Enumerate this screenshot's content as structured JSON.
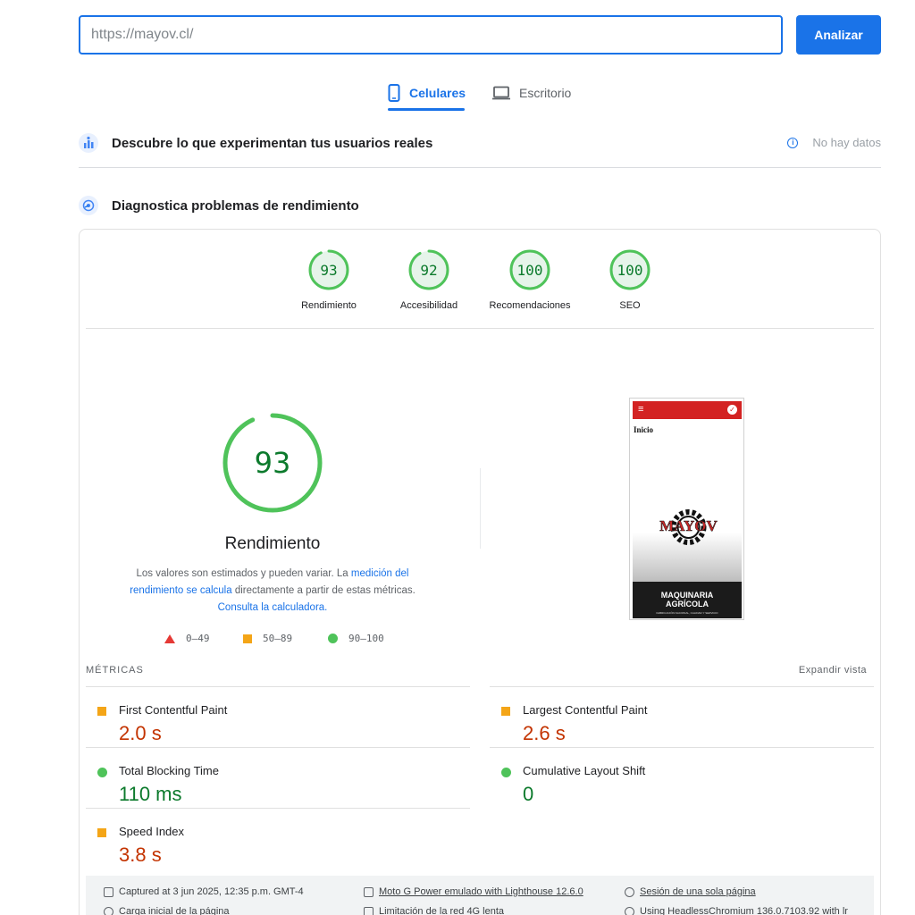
{
  "search": {
    "value": "https://mayov.cl/",
    "button": "Analizar"
  },
  "tabs": [
    {
      "label": "Celulares",
      "icon": "smartphone-icon",
      "active": true
    },
    {
      "label": "Escritorio",
      "icon": "laptop-icon",
      "active": false
    }
  ],
  "field_data": {
    "title": "Descubre lo que experimentan tus usuarios reales",
    "status": "No hay datos"
  },
  "lab_data": {
    "title": "Diagnostica problemas de rendimiento"
  },
  "categories": [
    {
      "score": "93",
      "label": "Rendimiento",
      "value": 93
    },
    {
      "score": "92",
      "label": "Accesibilidad",
      "value": 92
    },
    {
      "score": "100",
      "label": "Recomendaciones",
      "value": 100
    },
    {
      "score": "100",
      "label": "SEO",
      "value": 100
    }
  ],
  "performance": {
    "score": "93",
    "value": 93,
    "label": "Rendimiento",
    "desc_1": "Los valores son estimados y pueden variar. La ",
    "desc_link_1": "medición del rendimiento se calcula",
    "desc_2": " directamente a partir de estas métricas. ",
    "desc_link_2": "Consulta la calculadora."
  },
  "legend": [
    {
      "range": "0–49",
      "shape": "triangle",
      "color": "#e53935"
    },
    {
      "range": "50–89",
      "shape": "square",
      "color": "#f4a517"
    },
    {
      "range": "90–100",
      "shape": "circle",
      "color": "#4fc35a"
    }
  ],
  "preview": {
    "page_heading": "Inicio",
    "brand": "MAYOV",
    "tagline_1": "MAQUINARIA",
    "tagline_2": "AGRÍCOLA",
    "fine_print": "FABRICACIÓN NACIONAL, CALIDAD Y SERVICIO"
  },
  "metrics": {
    "title": "MÉTRICAS",
    "expand": "Expandir vista",
    "items": [
      {
        "name": "First Contentful Paint",
        "value": "2.0 s",
        "rating": "average"
      },
      {
        "name": "Largest Contentful Paint",
        "value": "2.6 s",
        "rating": "average"
      },
      {
        "name": "Total Blocking Time",
        "value": "110 ms",
        "rating": "pass"
      },
      {
        "name": "Cumulative Layout Shift",
        "value": "0",
        "rating": "pass"
      },
      {
        "name": "Speed Index",
        "value": "3.8 s",
        "rating": "average"
      }
    ]
  },
  "footer": {
    "captured": "Captured at 3 jun 2025, 12:35 p.m. GMT-4",
    "device": "Moto G Power emulado with Lighthouse 12.6.0",
    "session": "Sesión de una sola página",
    "load": "Carga inicial de la página",
    "network": "Limitación de la red 4G lenta",
    "browser": "Using HeadlessChromium 136.0.7103.92 with lr"
  },
  "colors": {
    "accent": "#1a73e8",
    "pass": "#0c7a2c",
    "pass_fill": "#e6f4ea",
    "pass_ring": "#4fc35a",
    "average": "#c33300",
    "average_icon": "#f4a517"
  }
}
